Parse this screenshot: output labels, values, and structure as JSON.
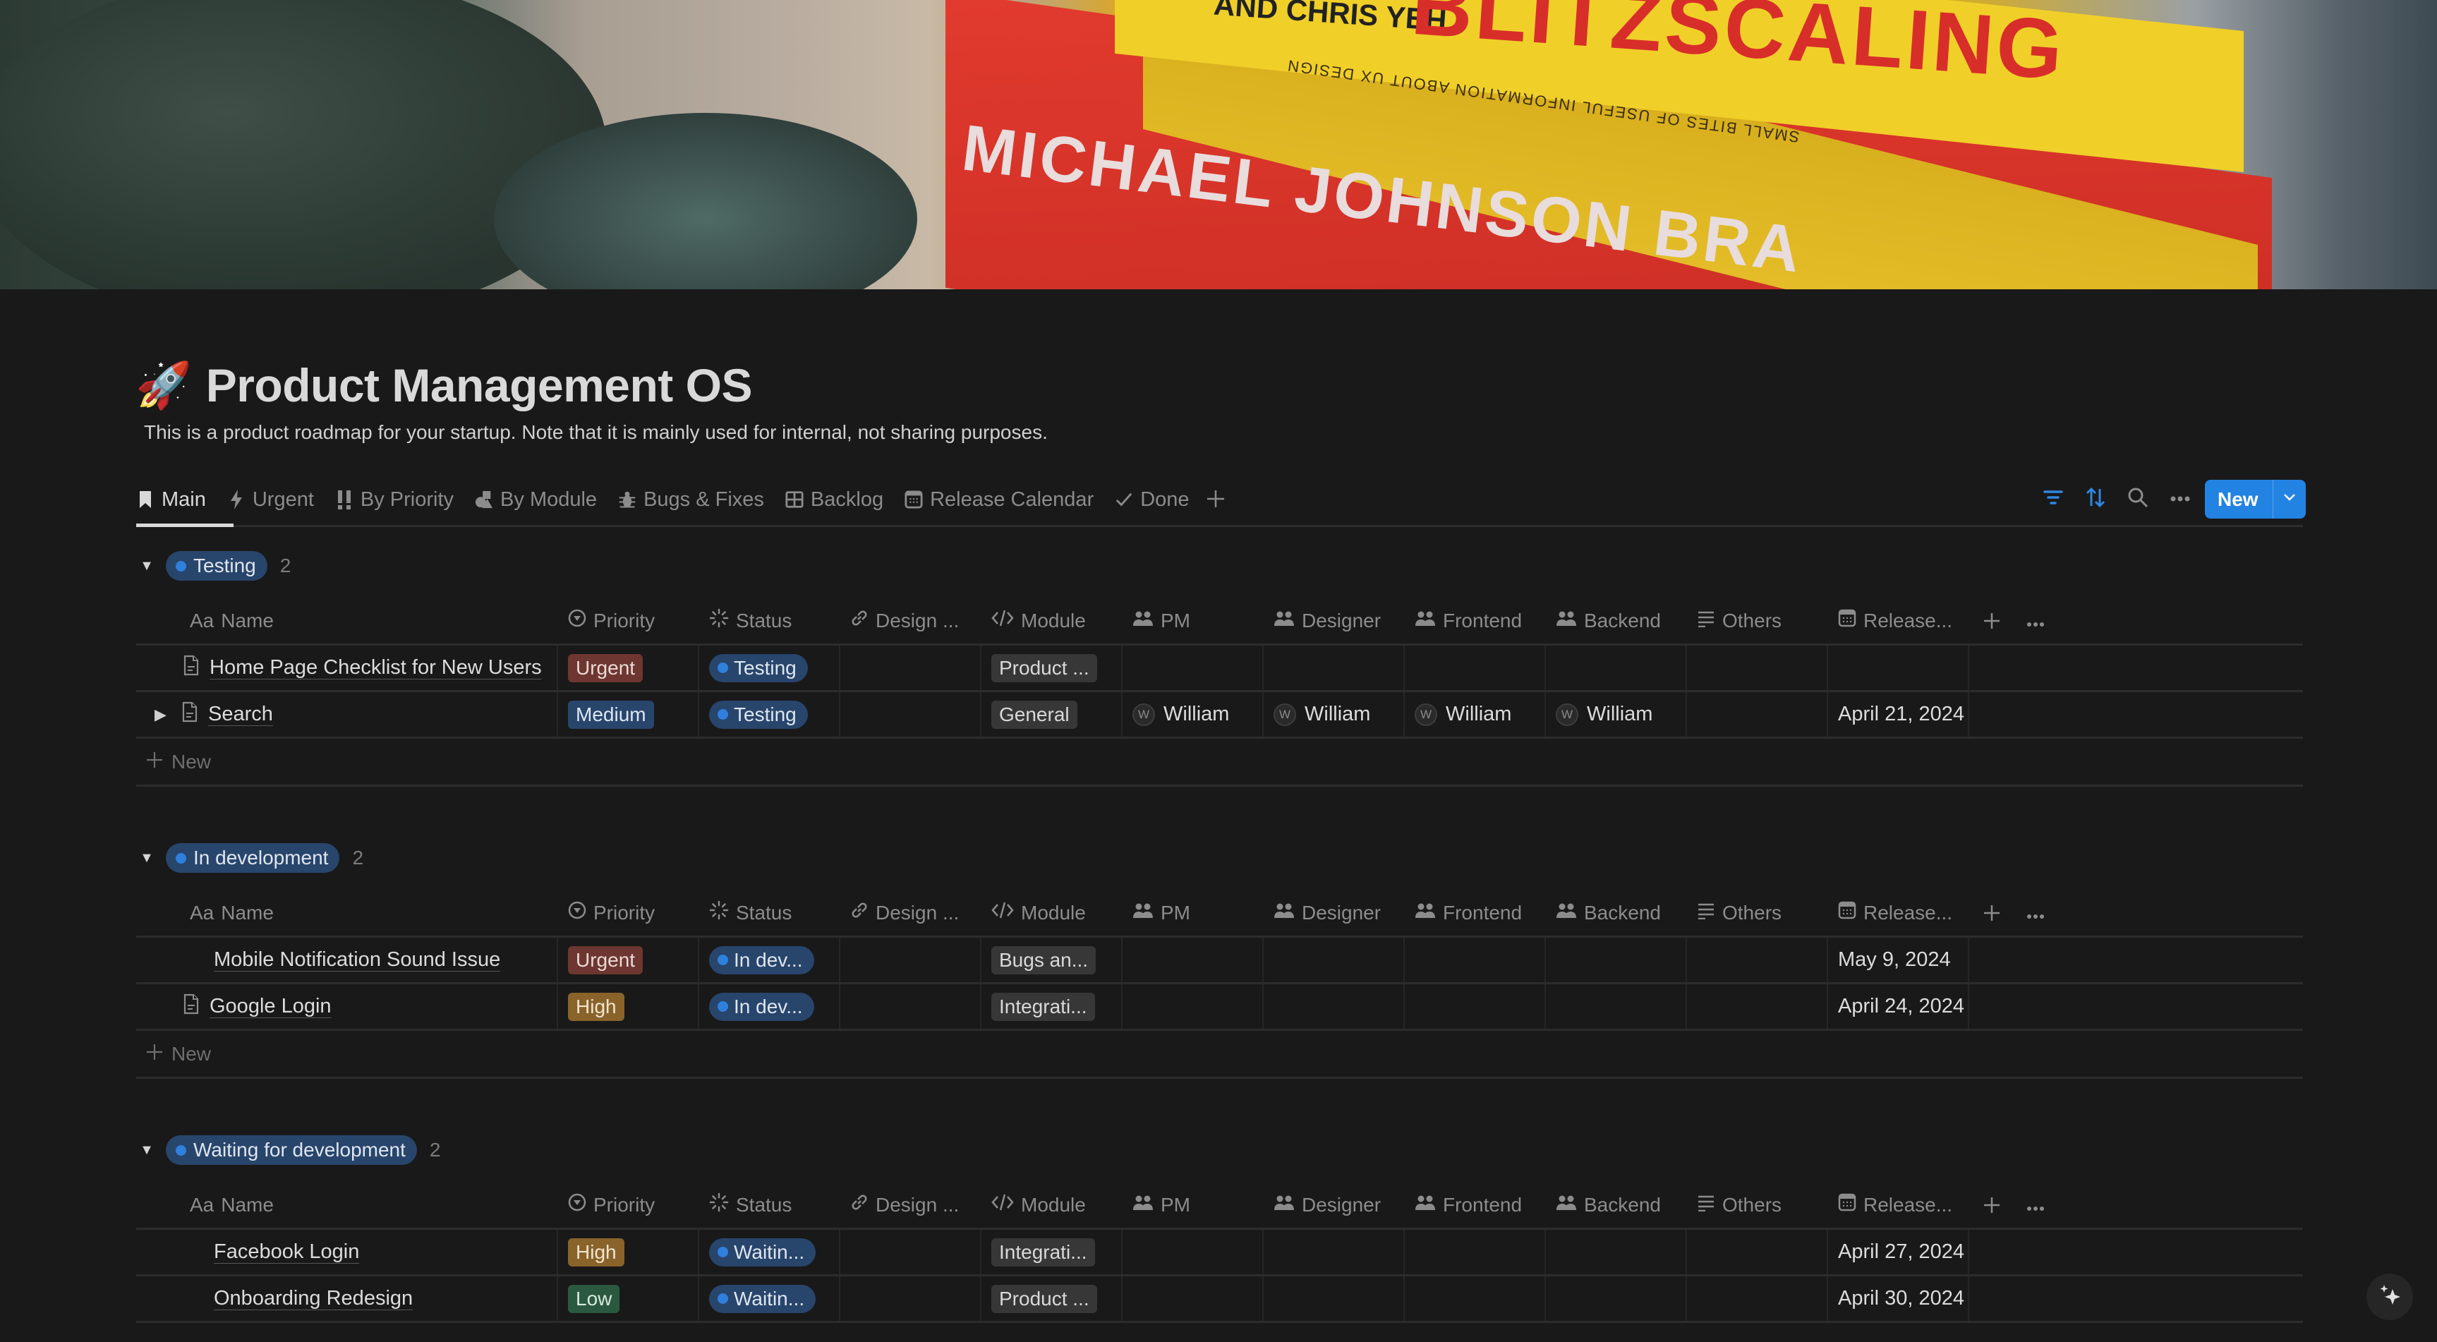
{
  "page": {
    "emoji": "🚀",
    "title": "Product Management OS",
    "description": "This is a product roadmap for your startup. Note that it is mainly used for internal, not sharing purposes."
  },
  "cover": {
    "author_text": "AND CHRIS YEH",
    "book_title": "BLITZSCALING",
    "small_text": "SMALL BITES OF USEFUL INFORMATION ABOUT UX DESIGN",
    "spine_text": "MICHAEL JOHNSON BRA"
  },
  "tabs": [
    {
      "label": "Main",
      "icon": "bookmark-icon",
      "active": true
    },
    {
      "label": "Urgent",
      "icon": "lightning-icon"
    },
    {
      "label": "By Priority",
      "icon": "double-exclamation-icon"
    },
    {
      "label": "By Module",
      "icon": "shapes-icon"
    },
    {
      "label": "Bugs & Fixes",
      "icon": "bug-icon"
    },
    {
      "label": "Backlog",
      "icon": "table-icon"
    },
    {
      "label": "Release Calendar",
      "icon": "calendar-icon"
    },
    {
      "label": "Done",
      "icon": "check-icon"
    }
  ],
  "toolbar": {
    "new_label": "New",
    "accent": "#2383e2"
  },
  "columns": [
    {
      "label": "Name",
      "icon": "Aa"
    },
    {
      "label": "Priority",
      "icon": "select-icon"
    },
    {
      "label": "Status",
      "icon": "status-icon"
    },
    {
      "label": "Design ...",
      "icon": "link-icon"
    },
    {
      "label": "Module",
      "icon": "code-icon"
    },
    {
      "label": "PM",
      "icon": "people-icon"
    },
    {
      "label": "Designer",
      "icon": "people-icon"
    },
    {
      "label": "Frontend",
      "icon": "people-icon"
    },
    {
      "label": "Backend",
      "icon": "people-icon"
    },
    {
      "label": "Others",
      "icon": "list-icon"
    },
    {
      "label": "Release...",
      "icon": "calendar-icon"
    }
  ],
  "new_row_label": "New",
  "groups": [
    {
      "status": "Testing",
      "count": "2",
      "rows": [
        {
          "name": "Home Page Checklist for New Users",
          "doc_icon": true,
          "expandable": false,
          "priority": "Urgent",
          "priority_class": "urgent",
          "status": "Testing",
          "module": "Product ...",
          "pm": "",
          "designer": "",
          "frontend": "",
          "backend": "",
          "release": ""
        },
        {
          "name": "Search",
          "doc_icon": true,
          "expandable": true,
          "priority": "Medium",
          "priority_class": "medium",
          "status": "Testing",
          "module": "General",
          "pm": "William",
          "designer": "William",
          "frontend": "William",
          "backend": "William",
          "avatar_initial": "W",
          "release": "April 21, 2024"
        }
      ]
    },
    {
      "status": "In development",
      "count": "2",
      "rows": [
        {
          "name": "Mobile Notification Sound Issue",
          "doc_icon": false,
          "expandable": false,
          "priority": "Urgent",
          "priority_class": "urgent",
          "status": "In dev...",
          "module": "Bugs an...",
          "release": "May 9, 2024"
        },
        {
          "name": "Google Login",
          "doc_icon": true,
          "expandable": false,
          "priority": "High",
          "priority_class": "high",
          "status": "In dev...",
          "module": "Integrati...",
          "release": "April 24, 2024"
        }
      ]
    },
    {
      "status": "Waiting for development",
      "count": "2",
      "rows": [
        {
          "name": "Facebook Login",
          "doc_icon": false,
          "expandable": false,
          "priority": "High",
          "priority_class": "high",
          "status": "Waitin...",
          "module": "Integrati...",
          "release": "April 27, 2024"
        },
        {
          "name": "Onboarding Redesign",
          "doc_icon": false,
          "expandable": false,
          "priority": "Low",
          "priority_class": "low",
          "status": "Waitin...",
          "module": "Product ...",
          "release": "April 30, 2024"
        }
      ]
    }
  ]
}
